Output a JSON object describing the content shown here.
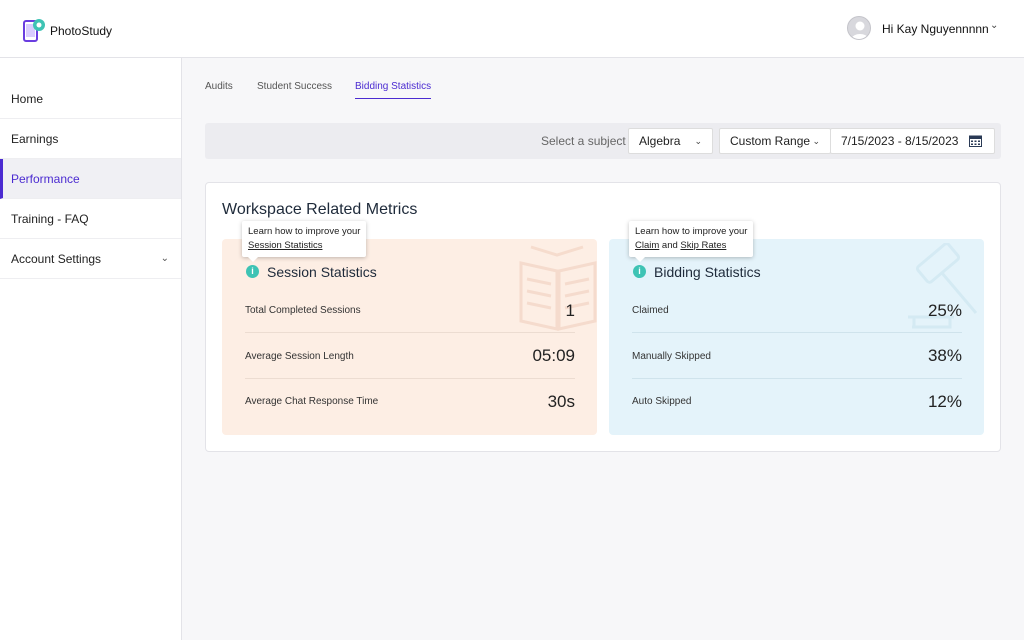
{
  "app": {
    "name": "PhotoStudy"
  },
  "user": {
    "greeting": "Hi Kay Nguyennnnn"
  },
  "sidebar": {
    "items": [
      {
        "label": "Home"
      },
      {
        "label": "Earnings"
      },
      {
        "label": "Performance",
        "active": true
      },
      {
        "label": "Training - FAQ"
      },
      {
        "label": "Account Settings",
        "expandable": true
      }
    ]
  },
  "tabs": [
    {
      "label": "Audits"
    },
    {
      "label": "Student Success"
    },
    {
      "label": "Bidding Statistics",
      "active": true
    }
  ],
  "filters": {
    "subject_label": "Select a subject",
    "subject_value": "Algebra",
    "range_value": "Custom Range",
    "date_range": "7/15/2023 - 8/15/2023"
  },
  "panel": {
    "title": "Workspace Related Metrics"
  },
  "session_card": {
    "title": "Session Statistics",
    "tooltip_line1": "Learn how to improve your",
    "tooltip_link": "Session Statistics",
    "rows": [
      {
        "label": "Total Completed Sessions",
        "value": "1"
      },
      {
        "label": "Average Session Length",
        "value": "05:09"
      },
      {
        "label": "Average Chat Response Time",
        "value": "30s"
      }
    ]
  },
  "bidding_card": {
    "title": "Bidding Statistics",
    "tooltip_line1": "Learn how to improve your",
    "tooltip_link1": "Claim",
    "tooltip_and": "and",
    "tooltip_link2": "Skip Rates",
    "rows": [
      {
        "label": "Claimed",
        "value": "25%"
      },
      {
        "label": "Manually Skipped",
        "value": "38%"
      },
      {
        "label": "Auto Skipped",
        "value": "12%"
      }
    ]
  },
  "colors": {
    "accent": "#4b2bd1",
    "session_bg": "#fdeee4",
    "bidding_bg": "#e4f3fa",
    "info": "#3ec3b4"
  }
}
